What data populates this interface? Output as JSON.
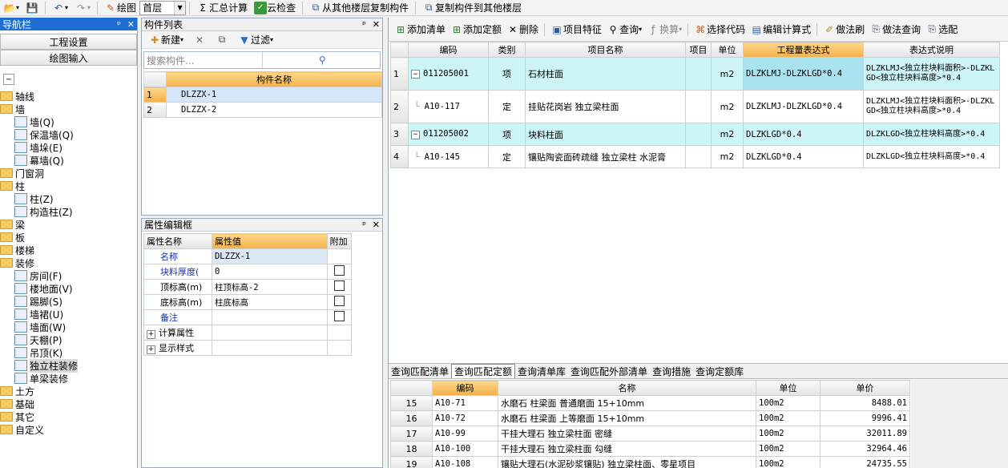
{
  "toolbar": {
    "draw_label": "绘图",
    "floor_value": "首层",
    "summary_label": "汇总计算",
    "cloud_check_label": "云检查",
    "copy_from_label": "从其他楼层复制构件",
    "copy_to_label": "复制构件到其他楼层"
  },
  "nav": {
    "title": "导航栏",
    "project_settings": "工程设置",
    "drawing_input": "绘图输入",
    "tree": [
      {
        "label": "轴线",
        "kind": "folder",
        "level": 0
      },
      {
        "label": "墙",
        "kind": "folder",
        "level": 0
      },
      {
        "label": "墙(Q)",
        "kind": "leaf",
        "level": 1
      },
      {
        "label": "保温墙(Q)",
        "kind": "leaf",
        "level": 1
      },
      {
        "label": "墙垛(E)",
        "kind": "leaf",
        "level": 1
      },
      {
        "label": "幕墙(Q)",
        "kind": "leaf",
        "level": 1
      },
      {
        "label": "门窗洞",
        "kind": "folder",
        "level": 0
      },
      {
        "label": "柱",
        "kind": "folder",
        "level": 0
      },
      {
        "label": "柱(Z)",
        "kind": "leaf",
        "level": 1
      },
      {
        "label": "构造柱(Z)",
        "kind": "leaf",
        "level": 1
      },
      {
        "label": "梁",
        "kind": "folder",
        "level": 0
      },
      {
        "label": "板",
        "kind": "folder",
        "level": 0
      },
      {
        "label": "楼梯",
        "kind": "folder",
        "level": 0
      },
      {
        "label": "装修",
        "kind": "folder",
        "level": 0
      },
      {
        "label": "房间(F)",
        "kind": "leaf",
        "level": 1
      },
      {
        "label": "楼地面(V)",
        "kind": "leaf",
        "level": 1
      },
      {
        "label": "踢脚(S)",
        "kind": "leaf",
        "level": 1
      },
      {
        "label": "墙裙(U)",
        "kind": "leaf",
        "level": 1
      },
      {
        "label": "墙面(W)",
        "kind": "leaf",
        "level": 1
      },
      {
        "label": "天棚(P)",
        "kind": "leaf",
        "level": 1
      },
      {
        "label": "吊顶(K)",
        "kind": "leaf",
        "level": 1
      },
      {
        "label": "独立柱装修",
        "kind": "leaf",
        "level": 1,
        "selected": true
      },
      {
        "label": "单梁装修",
        "kind": "leaf",
        "level": 1
      },
      {
        "label": "土方",
        "kind": "folder",
        "level": 0
      },
      {
        "label": "基础",
        "kind": "folder",
        "level": 0
      },
      {
        "label": "其它",
        "kind": "folder",
        "level": 0
      },
      {
        "label": "自定义",
        "kind": "folder",
        "level": 0
      }
    ]
  },
  "complist": {
    "title": "构件列表",
    "new_label": "新建",
    "filter_label": "过滤",
    "search_placeholder": "搜索构件...",
    "col_name": "构件名称",
    "rows": [
      {
        "no": "1",
        "name": "DLZZX-1"
      },
      {
        "no": "2",
        "name": "DLZZX-2"
      }
    ]
  },
  "props": {
    "title": "属性编辑框",
    "col_name": "属性名称",
    "col_value": "属性值",
    "col_extra": "附加",
    "rows": [
      {
        "name": "名称",
        "value": "DLZZX-1",
        "blue": true,
        "cb": false
      },
      {
        "name": "块料厚度(",
        "value": "0",
        "blue": true,
        "cb": true
      },
      {
        "name": "顶标高(m)",
        "value": "柱顶标高-2",
        "blue": false,
        "cb": true
      },
      {
        "name": "底标高(m)",
        "value": "柱底标高",
        "blue": false,
        "cb": true
      },
      {
        "name": "备注",
        "value": "",
        "blue": true,
        "cb": true
      },
      {
        "name": "计算属性",
        "value": "",
        "blue": false,
        "cb": false,
        "expand": true
      },
      {
        "name": "显示样式",
        "value": "",
        "blue": false,
        "cb": false,
        "expand": true
      }
    ]
  },
  "right_toolbar": {
    "add_list": "添加清单",
    "add_quota": "添加定额",
    "delete": "删除",
    "item_feature": "项目特征",
    "query": "查询",
    "convert": "换算",
    "select_code": "选择代码",
    "edit_formula": "编辑计算式",
    "method_brush": "做法刷",
    "method_query": "做法查询",
    "select_partial": "选配"
  },
  "main_table": {
    "headers": [
      "编码",
      "类别",
      "项目名称",
      "项目",
      "单位",
      "工程量表达式",
      "表达式说明"
    ],
    "rows": [
      {
        "no": "1",
        "code": "011205001",
        "type": "项",
        "name": "石材柱面",
        "unit": "m2",
        "expr": "DLZKLMJ-DLZKLGD*0.4",
        "desc": "DLZKLMJ<独立柱块料面积>-DLZKLGD<独立柱块料高度>*0.4",
        "list": true
      },
      {
        "no": "2",
        "code": "A10-117",
        "type": "定",
        "name": "挂贴花岗岩 独立梁柱面",
        "unit": "m2",
        "expr": "DLZKLMJ-DLZKLGD*0.4",
        "desc": "DLZKLMJ<独立柱块料面积>-DLZKLGD<独立柱块料高度>*0.4",
        "list": false
      },
      {
        "no": "3",
        "code": "011205002",
        "type": "项",
        "name": "块料柱面",
        "unit": "m2",
        "expr": "DLZKLGD*0.4",
        "desc": "DLZKLGD<独立柱块料高度>*0.4",
        "list": true
      },
      {
        "no": "4",
        "code": "A10-145",
        "type": "定",
        "name": "镶贴陶瓷面砖疏缝 独立梁柱 水泥膏",
        "unit": "m2",
        "expr": "DLZKLGD*0.4",
        "desc": "DLZKLGD<独立柱块料高度>*0.4",
        "list": false
      }
    ]
  },
  "bottom_tabs": [
    "查询匹配清单",
    "查询匹配定额",
    "查询清单库",
    "查询匹配外部清单",
    "查询措施",
    "查询定额库"
  ],
  "bottom_table": {
    "headers": [
      "编码",
      "名称",
      "单位",
      "单价"
    ],
    "rows": [
      {
        "no": "15",
        "code": "A10-71",
        "name": "水磨石 柱梁面 普通磨面 15+10mm",
        "unit": "100m2",
        "price": "8488.01"
      },
      {
        "no": "16",
        "code": "A10-72",
        "name": "水磨石 柱梁面 上等磨面 15+10mm",
        "unit": "100m2",
        "price": "9996.41"
      },
      {
        "no": "17",
        "code": "A10-99",
        "name": "干挂大理石 独立梁柱面 密缝",
        "unit": "100m2",
        "price": "32011.89"
      },
      {
        "no": "18",
        "code": "A10-100",
        "name": "干挂大理石 独立梁柱面 勾缝",
        "unit": "100m2",
        "price": "32964.46"
      },
      {
        "no": "19",
        "code": "A10-108",
        "name": "镶贴大理石(水泥砂浆镶贴) 独立梁柱面、零星项目",
        "unit": "100m2",
        "price": "24735.55"
      }
    ]
  }
}
